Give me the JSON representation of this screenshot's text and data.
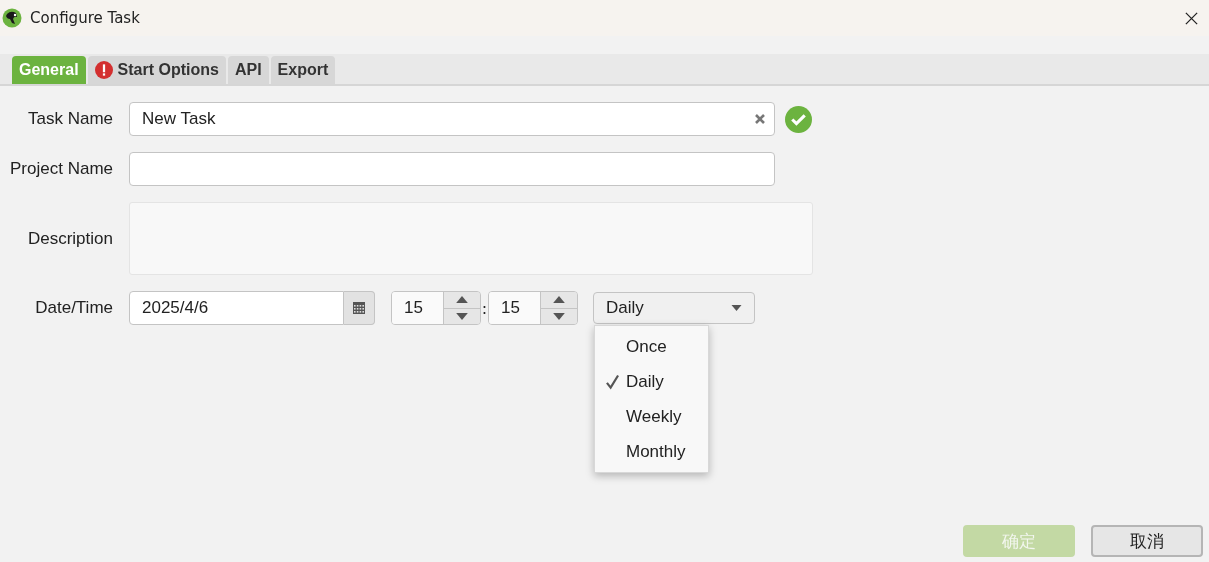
{
  "window": {
    "title": "Configure Task"
  },
  "tabs": [
    {
      "label": "General",
      "selected": true,
      "warning": false
    },
    {
      "label": "Start Options",
      "selected": false,
      "warning": true
    },
    {
      "label": "API",
      "selected": false,
      "warning": false
    },
    {
      "label": "Export",
      "selected": false,
      "warning": false
    }
  ],
  "form": {
    "task_name": {
      "label": "Task Name",
      "value": "New Task",
      "valid": true
    },
    "project_name": {
      "label": "Project Name"
    },
    "description": {
      "label": "Description"
    },
    "date_time": {
      "label": "Date/Time",
      "date": "2025/4/6",
      "hour": "15",
      "separator": ":",
      "minute": "15",
      "repeat": "Daily"
    }
  },
  "repeat_menu": {
    "open": true,
    "items": [
      {
        "label": "Once",
        "selected": false
      },
      {
        "label": "Daily",
        "selected": true
      },
      {
        "label": "Weekly",
        "selected": false
      },
      {
        "label": "Monthly",
        "selected": false
      }
    ]
  },
  "buttons": [
    {
      "label": "确定",
      "disabled": true
    },
    {
      "label": "取消",
      "disabled": false
    }
  ]
}
